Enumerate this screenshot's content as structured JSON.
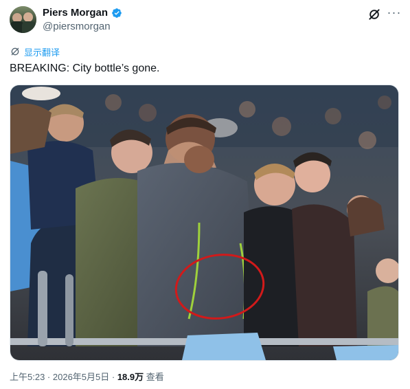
{
  "author": {
    "display_name": "Piers Morgan",
    "handle": "@piersmorgan"
  },
  "actions": {
    "grok_icon": "grok-slash-icon",
    "more_icon": "more-horizontal-icon",
    "more_label": "···"
  },
  "translate": {
    "icon": "globe-slash-icon",
    "label": "显示翻译"
  },
  "tweet": {
    "text": "BREAKING: City bottle’s gone."
  },
  "timestamp": {
    "time": "上午5:23",
    "sep1": " · ",
    "date": "2026年5月5日",
    "sep2": " · ",
    "views": "18.9万",
    "views_label": " 查看"
  },
  "colors": {
    "link": "#1d9bf0",
    "verified": "#1d9bf0",
    "muted": "#536471",
    "text": "#0f1419",
    "annotation_circle": "#d11a1a"
  }
}
